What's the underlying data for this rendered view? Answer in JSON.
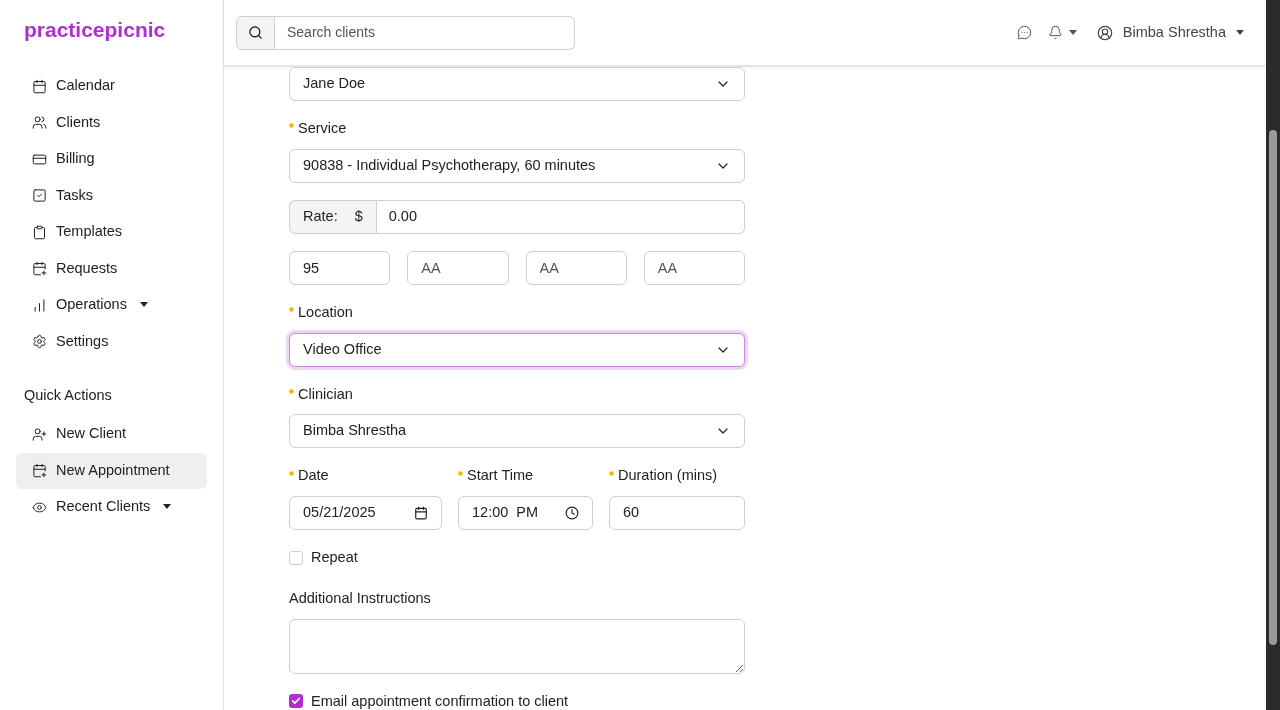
{
  "sidebar": {
    "logo": "practicepicnic",
    "items": [
      {
        "label": "Calendar",
        "expandable": false,
        "selected": false
      },
      {
        "label": "Clients",
        "expandable": false,
        "selected": false
      },
      {
        "label": "Billing",
        "expandable": false,
        "selected": false
      },
      {
        "label": "Tasks",
        "expandable": false,
        "selected": false
      },
      {
        "label": "Templates",
        "expandable": false,
        "selected": false
      },
      {
        "label": "Requests",
        "expandable": false,
        "selected": false
      },
      {
        "label": "Operations",
        "expandable": true,
        "selected": false
      },
      {
        "label": "Settings",
        "expandable": false,
        "selected": false
      }
    ],
    "quick_actions": {
      "title": "Quick Actions",
      "items": [
        {
          "label": "New Client",
          "expandable": false,
          "selected": false
        },
        {
          "label": "New Appointment",
          "expandable": false,
          "selected": true
        },
        {
          "label": "Recent Clients",
          "expandable": true,
          "selected": false
        }
      ]
    }
  },
  "header": {
    "search": {
      "placeholder": "Search clients"
    },
    "user": {
      "name": "Bimba Shrestha"
    }
  },
  "form": [
    {
      "kind": "select",
      "value": "Jane Doe",
      "focused": false
    },
    {
      "kind": "select",
      "label": "Service",
      "required": true,
      "value": "90838 - Individual Psychotherapy, 60 minutes",
      "focused": false
    },
    {
      "kind": "rate",
      "label": "Rate:",
      "prefix": "$",
      "value": "0.00"
    },
    {
      "kind": "codes",
      "fields": [
        {
          "value": "95"
        },
        {
          "placeholder": "AA"
        },
        {
          "placeholder": "AA"
        },
        {
          "placeholder": "AA"
        }
      ]
    },
    {
      "kind": "select",
      "label": "Location",
      "required": true,
      "value": "Video Office",
      "focused": true
    },
    {
      "kind": "select",
      "label": "Clinician",
      "required": true,
      "value": "Bimba Shrestha",
      "focused": false
    },
    {
      "kind": "row",
      "fields": [
        {
          "kind": "date",
          "label": "Date",
          "required": true,
          "value": "05/21/2025"
        },
        {
          "kind": "time",
          "label": "Start Time",
          "required": true,
          "value": "12:00  PM"
        },
        {
          "kind": "text",
          "label": "Duration (mins)",
          "required": true,
          "value": "60"
        }
      ]
    },
    {
      "kind": "checkbox",
      "label": "Repeat",
      "checked": false
    },
    {
      "kind": "textarea",
      "label": "Additional Instructions",
      "required": false
    },
    {
      "kind": "checkbox",
      "label": "Email appointment confirmation to client",
      "checked": true
    }
  ]
}
